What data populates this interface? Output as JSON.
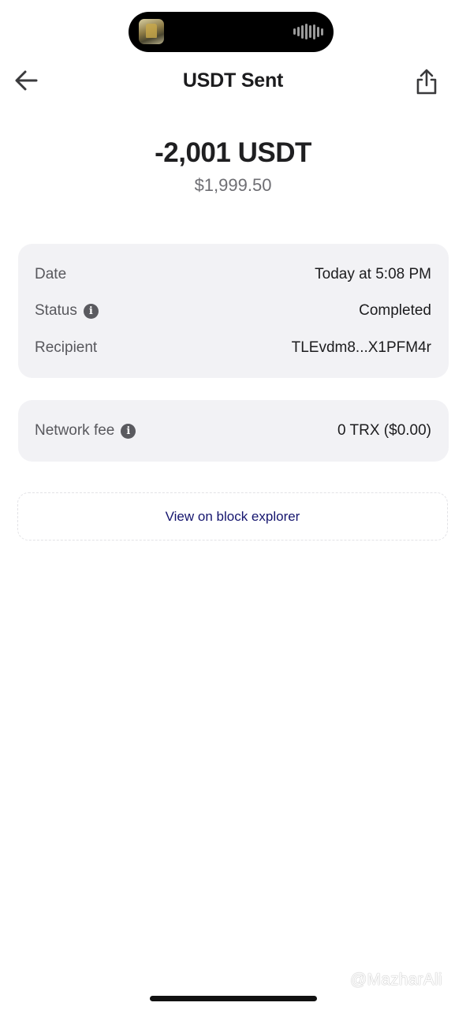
{
  "header": {
    "title": "USDT Sent"
  },
  "transaction": {
    "amount": "-2,001 USDT",
    "fiat_value": "$1,999.50"
  },
  "details": {
    "date_label": "Date",
    "date_value": "Today at 5:08 PM",
    "status_label": "Status",
    "status_value": "Completed",
    "recipient_label": "Recipient",
    "recipient_value": "TLEvdm8...X1PFM4r"
  },
  "fee": {
    "label": "Network fee",
    "value": "0 TRX ($0.00)"
  },
  "explorer": {
    "label": "View on block explorer"
  },
  "watermark": {
    "text": "@MazharAli"
  },
  "colors": {
    "card_background": "#f2f2f5",
    "link": "#15156e",
    "label": "#58585d",
    "value": "#1c1c1e"
  }
}
